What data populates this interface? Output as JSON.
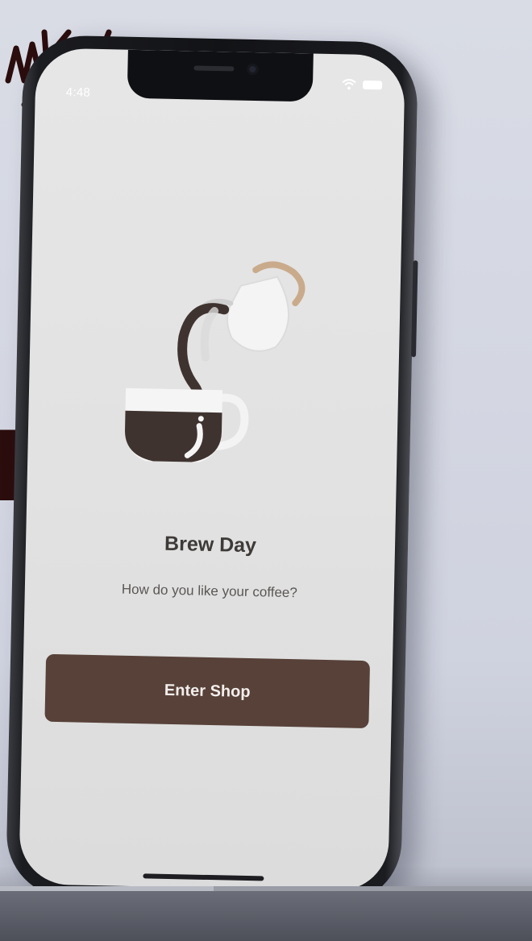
{
  "status_bar": {
    "time": "4:48",
    "icons": [
      "wifi-icon",
      "battery-icon"
    ]
  },
  "onboarding": {
    "illustration": "coffee-pour-illustration",
    "title": "Brew Day",
    "subtitle": "How do you like your coffee?",
    "cta_label": "Enter Shop"
  },
  "colors": {
    "button": "#574139",
    "coffee": "#3f3330",
    "milk_jug_handle": "#c9ab8c",
    "screen_bg": "#e4e4e4"
  }
}
